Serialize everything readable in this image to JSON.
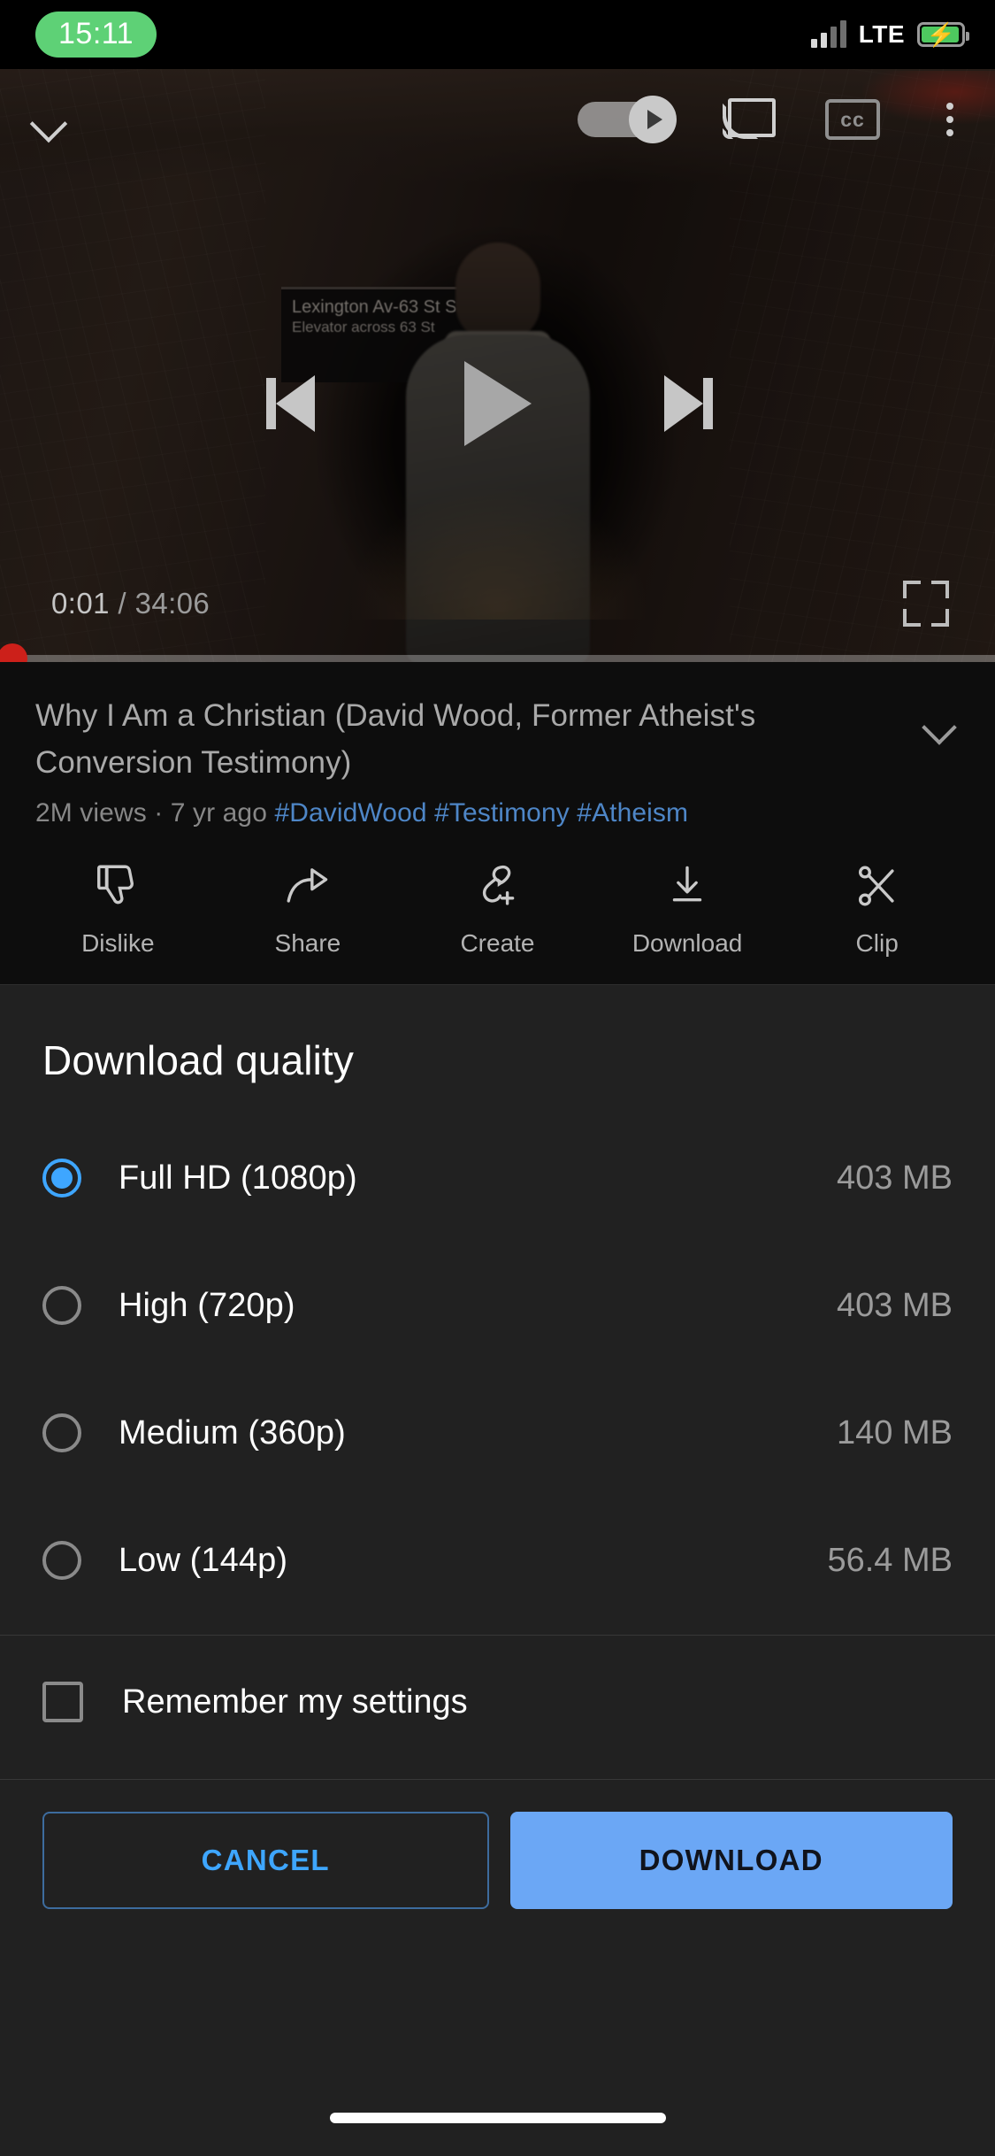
{
  "status_bar": {
    "time": "15:11",
    "network": "LTE",
    "signal_bars_filled": 2,
    "signal_bars_total": 4,
    "battery_charging": true,
    "time_pill_color": "#5ed176",
    "battery_color": "#4ec95f"
  },
  "player": {
    "collapse_icon": "chevron-down-icon",
    "autoplay_toggle": "on",
    "cast_icon": "cast-icon",
    "captions_icon": "closed-captions-icon",
    "overflow_icon": "more-vertical-icon",
    "previous_icon": "previous-track-icon",
    "play_icon": "play-icon",
    "next_icon": "next-track-icon",
    "current_time": "0:01",
    "separator": "/",
    "duration": "34:06",
    "fullscreen_icon": "fullscreen-icon",
    "progress_percent": 0,
    "scrubber_color": "#cc201a",
    "frame_sign_line1": "Lexington Av-63 St Sta",
    "frame_sign_line2": "Elevator across 63 St"
  },
  "video": {
    "title": "Why I Am a Christian (David Wood, Former Atheist's Conversion Testimony)",
    "views": "2M views",
    "dot": "·",
    "age": "7 yr ago",
    "hashtags": [
      "#DavidWood",
      "#Testimony",
      "#Atheism"
    ],
    "expand_icon": "chevron-down-icon",
    "hashtag_color": "#4e86c7"
  },
  "actions": [
    {
      "label": "Dislike",
      "icon": "thumbs-down-icon"
    },
    {
      "label": "Share",
      "icon": "share-arrow-icon"
    },
    {
      "label": "Create",
      "icon": "create-remix-icon"
    },
    {
      "label": "Download",
      "icon": "download-arrow-icon"
    },
    {
      "label": "Clip",
      "icon": "scissors-icon"
    }
  ],
  "sheet": {
    "title": "Download quality",
    "options": [
      {
        "label": "Full HD (1080p)",
        "size": "403 MB",
        "selected": true
      },
      {
        "label": "High (720p)",
        "size": "403 MB",
        "selected": false
      },
      {
        "label": "Medium (360p)",
        "size": "140 MB",
        "selected": false
      },
      {
        "label": "Low (144p)",
        "size": "56.4 MB",
        "selected": false
      }
    ],
    "remember_label": "Remember my settings",
    "remember_checked": false,
    "cancel_label": "CANCEL",
    "download_label": "DOWNLOAD",
    "accent_color": "#3ea6ff",
    "primary_button_color": "#6ba7f5"
  }
}
